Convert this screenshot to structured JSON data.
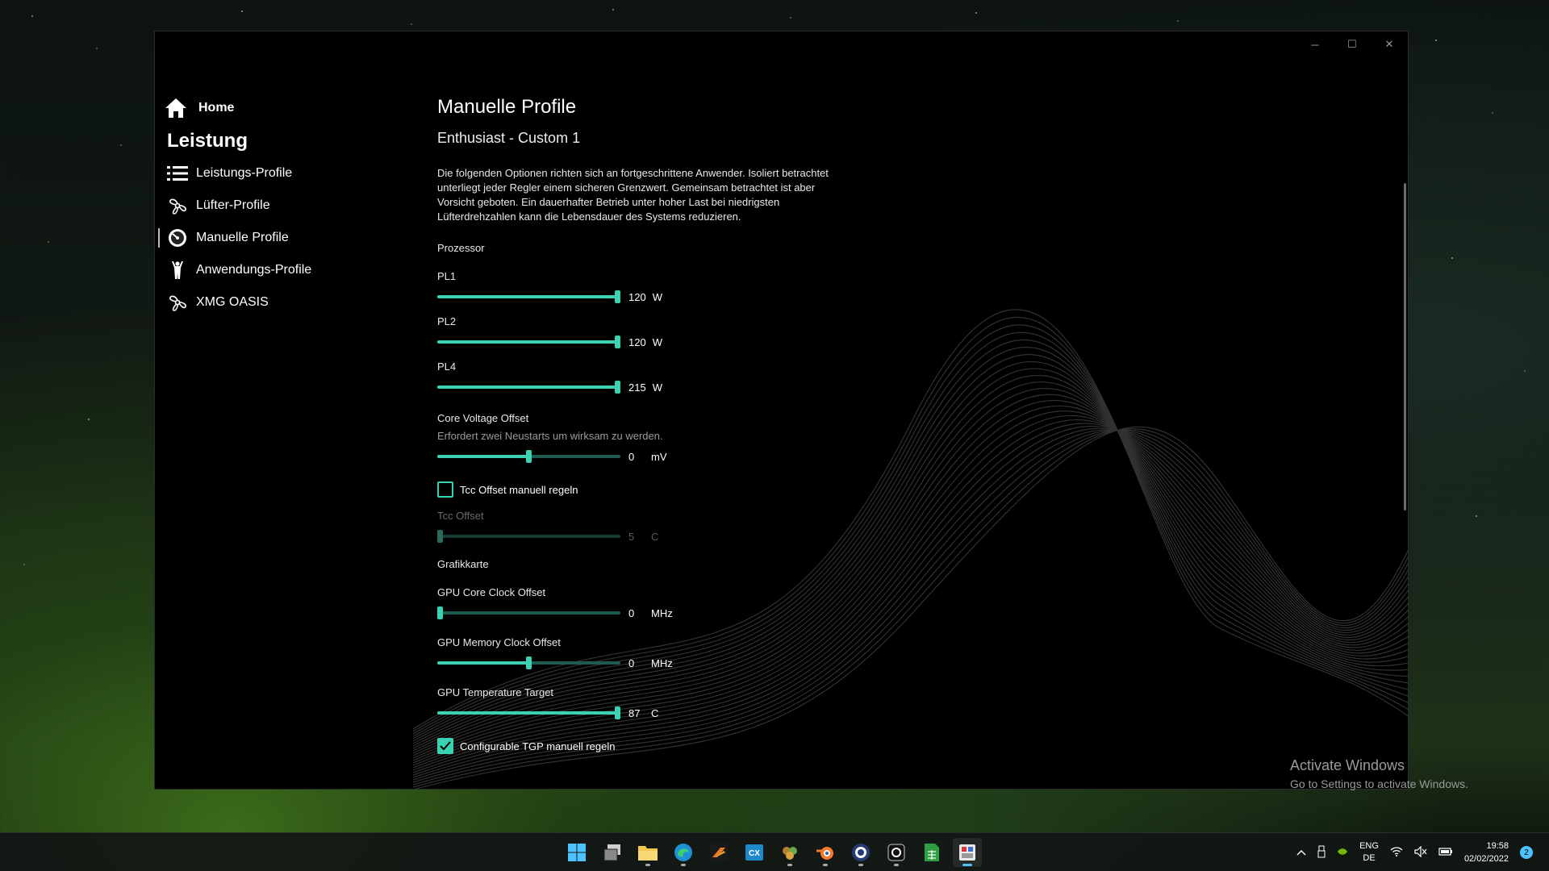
{
  "colors": {
    "accent": "#3ad2b2",
    "track": "#1f5b4f"
  },
  "window": {
    "minimize_glyph": "─",
    "maximize_glyph": "☐",
    "close_glyph": "✕"
  },
  "sidebar": {
    "home_label": "Home",
    "section_title": "Leistung",
    "items": [
      {
        "label": "Leistungs-Profile",
        "icon": "list-icon"
      },
      {
        "label": "Lüfter-Profile",
        "icon": "fan-icon"
      },
      {
        "label": "Manuelle Profile",
        "icon": "gauge-icon",
        "active": true
      },
      {
        "label": "Anwendungs-Profile",
        "icon": "person-icon"
      },
      {
        "label": "XMG OASIS",
        "icon": "fan-icon"
      }
    ]
  },
  "main": {
    "title": "Manuelle Profile",
    "subtitle": "Enthusiast - Custom 1",
    "description": "Die folgenden Optionen richten sich an fortgeschrittene Anwender. Isoliert betrachtet unterliegt jeder Regler einem sicheren Grenzwert. Gemeinsam betrachtet ist aber Vorsicht geboten. Ein dauerhafter Betrieb unter hoher Last bei niedrigsten Lüfterdrehzahlen kann die Lebensdauer des Systems reduzieren.",
    "processor_header": "Prozessor",
    "pl1": {
      "label": "PL1",
      "value": "120",
      "unit": "W",
      "fraction": 1.0
    },
    "pl2": {
      "label": "PL2",
      "value": "120",
      "unit": "W",
      "fraction": 1.0
    },
    "pl4": {
      "label": "PL4",
      "value": "215",
      "unit": "W",
      "fraction": 1.0
    },
    "core_voltage": {
      "label": "Core Voltage Offset",
      "hint": "Erfordert zwei Neustarts um wirksam zu werden.",
      "value": "0",
      "unit": "mV",
      "fraction": 0.5
    },
    "tcc_checkbox": {
      "label": "Tcc Offset manuell regeln",
      "checked": false
    },
    "tcc": {
      "label": "Tcc Offset",
      "value": "5",
      "unit": "C",
      "fraction": 0.0
    },
    "gpu_header": "Grafikkarte",
    "gpu_core": {
      "label": "GPU Core Clock Offset",
      "value": "0",
      "unit": "MHz",
      "fraction": 0.0
    },
    "gpu_mem": {
      "label": "GPU Memory Clock Offset",
      "value": "0",
      "unit": "MHz",
      "fraction": 0.5
    },
    "gpu_temp": {
      "label": "GPU Temperature Target",
      "value": "87",
      "unit": "C",
      "fraction": 1.0
    },
    "tgp_checkbox": {
      "label": "Configurable TGP manuell regeln",
      "checked": true
    }
  },
  "watermark": {
    "line1": "Activate Windows",
    "line2": "Go to Settings to activate Windows."
  },
  "taskbar": {
    "apps": [
      "windows-start-icon",
      "task-view-icon",
      "file-explorer-icon",
      "edge-icon",
      "app-icon",
      "cx-icon",
      "app-icon",
      "blender-icon",
      "app-icon",
      "app-icon",
      "spreadsheet-icon",
      "control-center-icon"
    ],
    "cx_label": "CX",
    "lang_line1": "ENG",
    "lang_line2": "DE",
    "time": "19:58",
    "date": "02/02/2022",
    "notification_count": "2"
  }
}
